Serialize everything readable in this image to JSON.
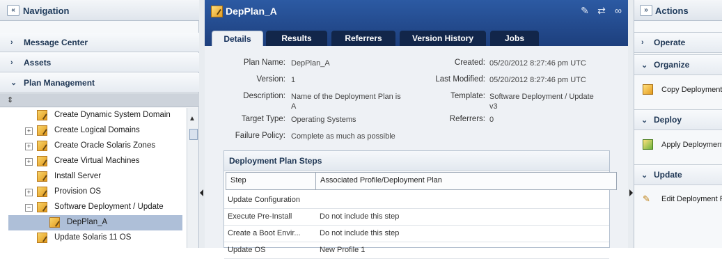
{
  "navigation": {
    "title": "Navigation",
    "collapse_glyph": "«",
    "accordions": [
      "Message Center",
      "Assets",
      "Plan Management"
    ],
    "sort_glyph": "⇕",
    "tree": [
      {
        "label": "Create Dynamic System Domain",
        "expander": ""
      },
      {
        "label": "Create Logical Domains",
        "expander": "+"
      },
      {
        "label": "Create Oracle Solaris Zones",
        "expander": "+"
      },
      {
        "label": "Create Virtual Machines",
        "expander": "+"
      },
      {
        "label": "Install Server",
        "expander": ""
      },
      {
        "label": "Provision OS",
        "expander": "+"
      },
      {
        "label": "Software Deployment / Update",
        "expander": "−"
      },
      {
        "label": "DepPlan_A",
        "expander": ""
      },
      {
        "label": "Update Solaris 11 OS",
        "expander": ""
      }
    ],
    "selected_item": "DepPlan_A"
  },
  "plan": {
    "title": "DepPlan_A",
    "tabs": [
      "Details",
      "Results",
      "Referrers",
      "Version History",
      "Jobs"
    ],
    "active_tab": "Details",
    "fields": {
      "plan_name_label": "Plan Name:",
      "plan_name": "DepPlan_A",
      "version_label": "Version:",
      "version": "1",
      "description_label": "Description:",
      "description_line1": "Name of the Deployment Plan is",
      "description_line2": "A",
      "target_type_label": "Target Type:",
      "target_type": "Operating Systems",
      "failure_policy_label": "Failure Policy:",
      "failure_policy": "Complete as much as possible",
      "created_label": "Created:",
      "created": "05/20/2012 8:27:46 pm UTC",
      "last_modified_label": "Last Modified:",
      "last_modified": "05/20/2012 8:27:46 pm UTC",
      "template_label": "Template:",
      "template_line1": "Software Deployment / Update",
      "template_line2": "v3",
      "referrers_label": "Referrers:",
      "referrers": "0"
    },
    "steps": {
      "title": "Deployment Plan Steps",
      "columns": [
        "Step",
        "Associated Profile/Deployment Plan"
      ],
      "rows": [
        {
          "step": "Update Configuration",
          "profile": ""
        },
        {
          "step": "Execute Pre-Install",
          "profile": "Do not include this step"
        },
        {
          "step": "Create a Boot Envir...",
          "profile": "Do not include this step"
        },
        {
          "step": "Update OS",
          "profile": "New Profile 1"
        }
      ]
    },
    "header_icons": [
      "edit-plan-icon",
      "compare-icon",
      "link-icon"
    ]
  },
  "actions": {
    "title": "Actions",
    "expand_glyph": "»",
    "sections": [
      {
        "label": "Operate",
        "items": []
      },
      {
        "label": "Organize",
        "items": [
          "Copy Deployment Plan"
        ]
      },
      {
        "label": "Deploy",
        "items": [
          "Apply Deployment Plan"
        ]
      },
      {
        "label": "Update",
        "items": [
          "Edit Deployment Plan"
        ]
      }
    ]
  },
  "colors": {
    "header_blue": "#2c5aa3",
    "tab_dark": "#12264a",
    "selection": "#aebfd8"
  }
}
